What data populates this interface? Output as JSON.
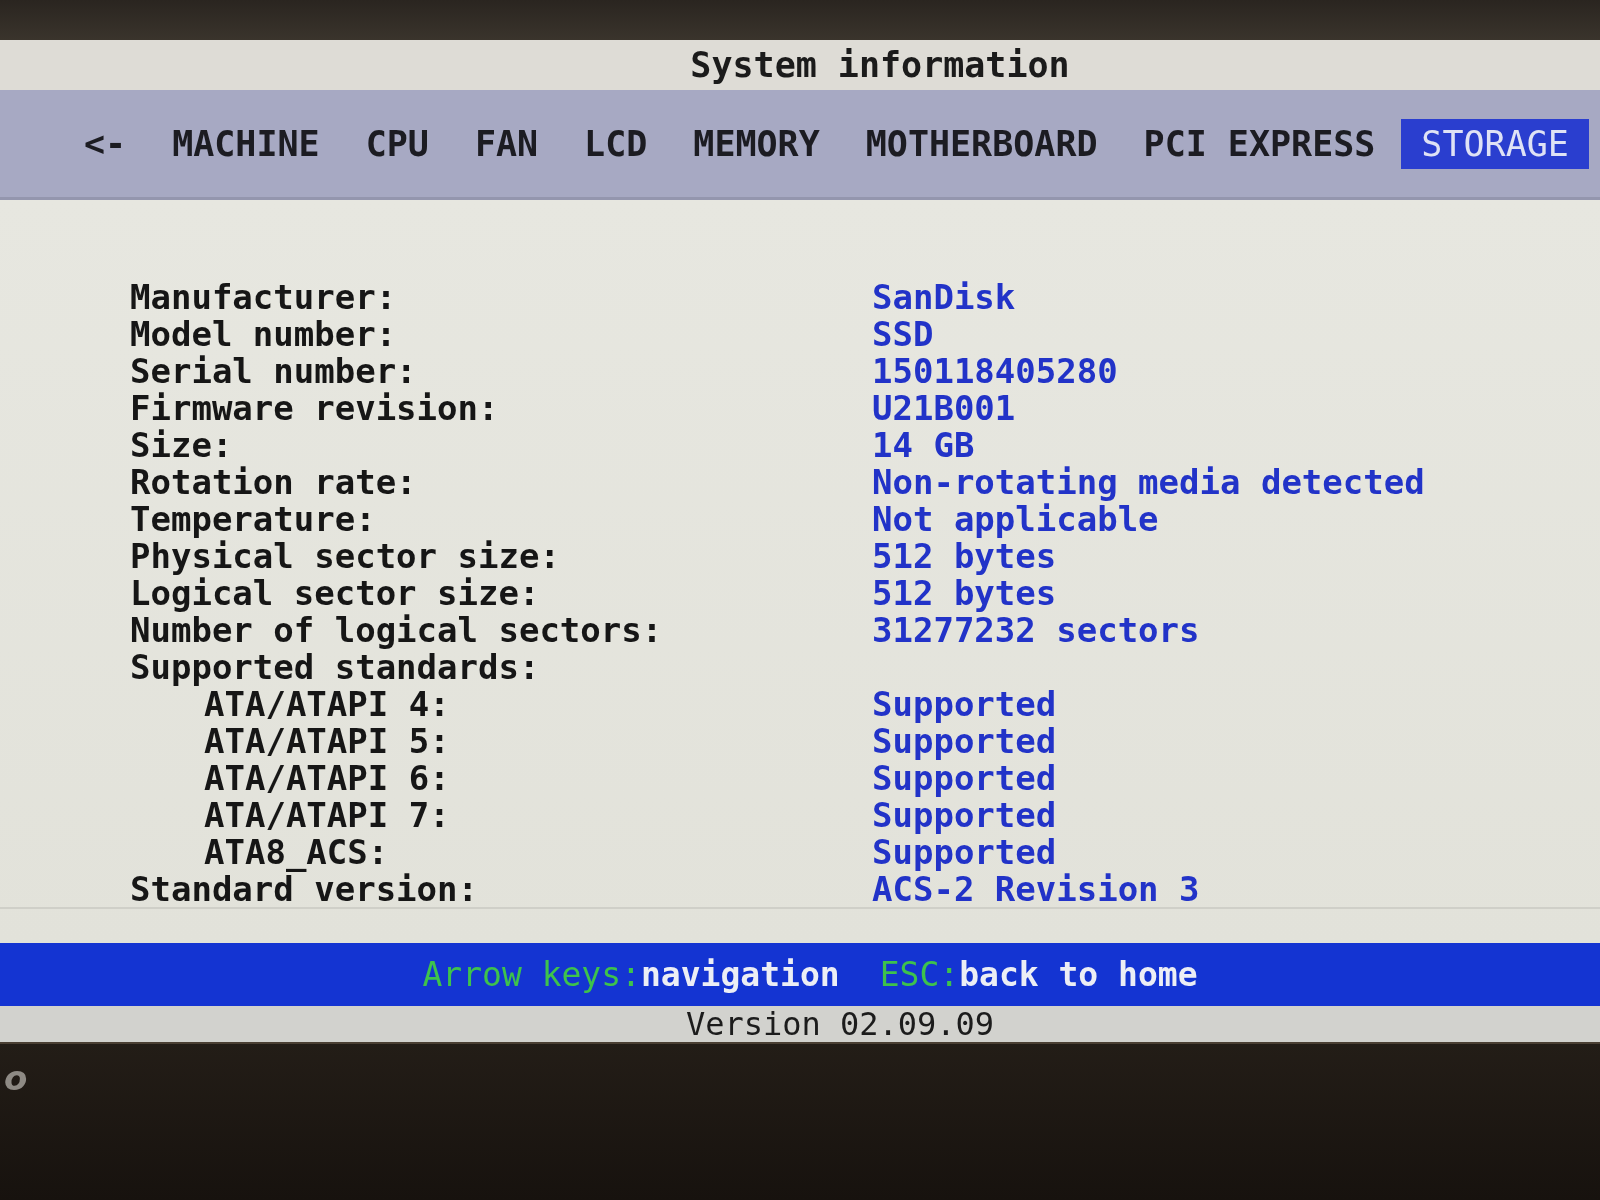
{
  "title": "System information",
  "nav": {
    "back": "<-",
    "tabs": [
      {
        "label": "MACHINE",
        "selected": false
      },
      {
        "label": "CPU",
        "selected": false
      },
      {
        "label": "FAN",
        "selected": false
      },
      {
        "label": "LCD",
        "selected": false
      },
      {
        "label": "MEMORY",
        "selected": false
      },
      {
        "label": "MOTHERBOARD",
        "selected": false
      },
      {
        "label": "PCI EXPRESS",
        "selected": false
      },
      {
        "label": "STORAGE",
        "selected": true
      }
    ]
  },
  "fields": [
    {
      "label": "Manufacturer:",
      "value": "SanDisk"
    },
    {
      "label": "Model number:",
      "value": "SSD"
    },
    {
      "label": "Serial number:",
      "value": "150118405280"
    },
    {
      "label": "Firmware revision:",
      "value": "U21B001"
    },
    {
      "label": "Size:",
      "value": "14 GB"
    },
    {
      "label": "Rotation rate:",
      "value": "Non-rotating media detected"
    },
    {
      "label": "Temperature:",
      "value": "Not applicable"
    },
    {
      "label": "Physical sector size:",
      "value": "512 bytes"
    },
    {
      "label": "Logical sector size:",
      "value": "512 bytes"
    },
    {
      "label": "Number of logical sectors:",
      "value": "31277232 sectors"
    },
    {
      "label": "Supported standards:",
      "children": [
        {
          "label": "ATA/ATAPI 4:",
          "value": "Supported"
        },
        {
          "label": "ATA/ATAPI 5:",
          "value": "Supported"
        },
        {
          "label": "ATA/ATAPI 6:",
          "value": "Supported"
        },
        {
          "label": "ATA/ATAPI 7:",
          "value": "Supported"
        },
        {
          "label": "ATA8_ACS:",
          "value": "Supported"
        }
      ]
    },
    {
      "label": "Standard version:",
      "value": "ACS-2 Revision 3"
    }
  ],
  "footer": {
    "hints": [
      {
        "key": "Arrow keys:",
        "action": "navigation"
      },
      {
        "key": "ESC:",
        "action": "back to home"
      }
    ]
  },
  "version": "Version 02.09.09",
  "bezel": {
    "logo": "o"
  }
}
